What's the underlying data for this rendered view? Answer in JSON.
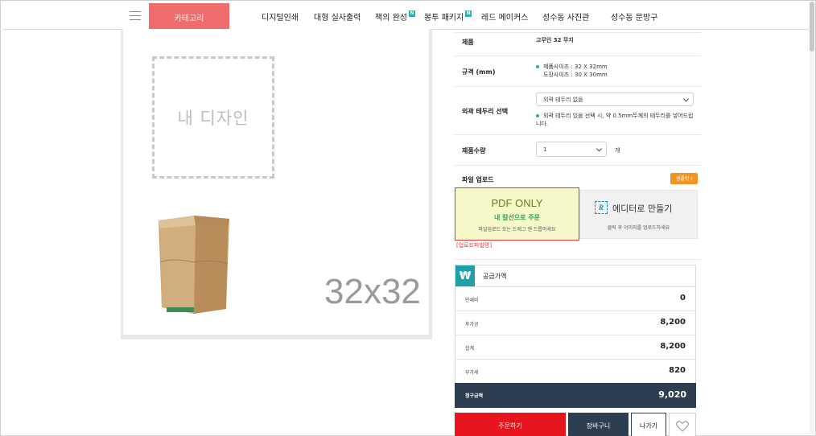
{
  "nav": {
    "category_label": "카테고리",
    "items": [
      {
        "label": "디지털인쇄",
        "badge": ""
      },
      {
        "label": "대형 실사출력",
        "badge": ""
      },
      {
        "label": "책의 완성",
        "badge": "N"
      },
      {
        "label": "봉투 패키지",
        "badge": "N"
      },
      {
        "label": "레드 메이커스",
        "badge": ""
      },
      {
        "label": "성수동 사진관",
        "badge": ""
      },
      {
        "label": "성수동 문방구",
        "badge": ""
      }
    ]
  },
  "preview": {
    "placeholder": "내 디자인",
    "size_text": "32x32"
  },
  "options": {
    "product_label": "제품",
    "product_value": "고무인 32 무지",
    "spec_label": "규격 (mm)",
    "spec_line1": "제품사이즈 : 32 X 32mm",
    "spec_line2": "도장사이즈 : 30 X 30mm",
    "border_label": "외곽 테두리 선택",
    "border_selected": "외곽 테두리 없음",
    "border_note": "외곽 테두리 있음 선택 시, 약 0.5mm두께의 테두리를 넣어드립니다.",
    "qty_label": "제품수량",
    "qty_selected": "1",
    "qty_unit": "개",
    "upload_label": "파일 업로드",
    "sample_label": "샘플킷 ⭳"
  },
  "upload": {
    "pdf_title": "PDF ONLY",
    "pdf_sub": "내 칼선으로 주문",
    "pdf_hint": "파일업로드 또는 드래그 앤 드롭하세요",
    "editor_icon": "R",
    "editor_title": "에디터로 만들기",
    "editor_hint": "클릭 후 이미지를 업로드하세요",
    "filename": "[업로드파일명]"
  },
  "price": {
    "icon": "₩",
    "header": "공급가액",
    "rows": [
      {
        "label": "인쇄비",
        "value": "0"
      },
      {
        "label": "후가공",
        "value": "8,200"
      },
      {
        "label": "합계",
        "value": "8,200"
      },
      {
        "label": "부가세",
        "value": "820"
      }
    ],
    "total_label": "청구금액",
    "total_value": "9,020"
  },
  "actions": {
    "order": "주문하기",
    "cart": "장바구니",
    "exit": "나가기",
    "like_icon": "heart-icon"
  },
  "colors": {
    "category": "#f06c6c",
    "accent_teal": "#1fa0a8",
    "order": "#e8141e",
    "navy": "#2c3e50",
    "sample": "#f29424"
  }
}
